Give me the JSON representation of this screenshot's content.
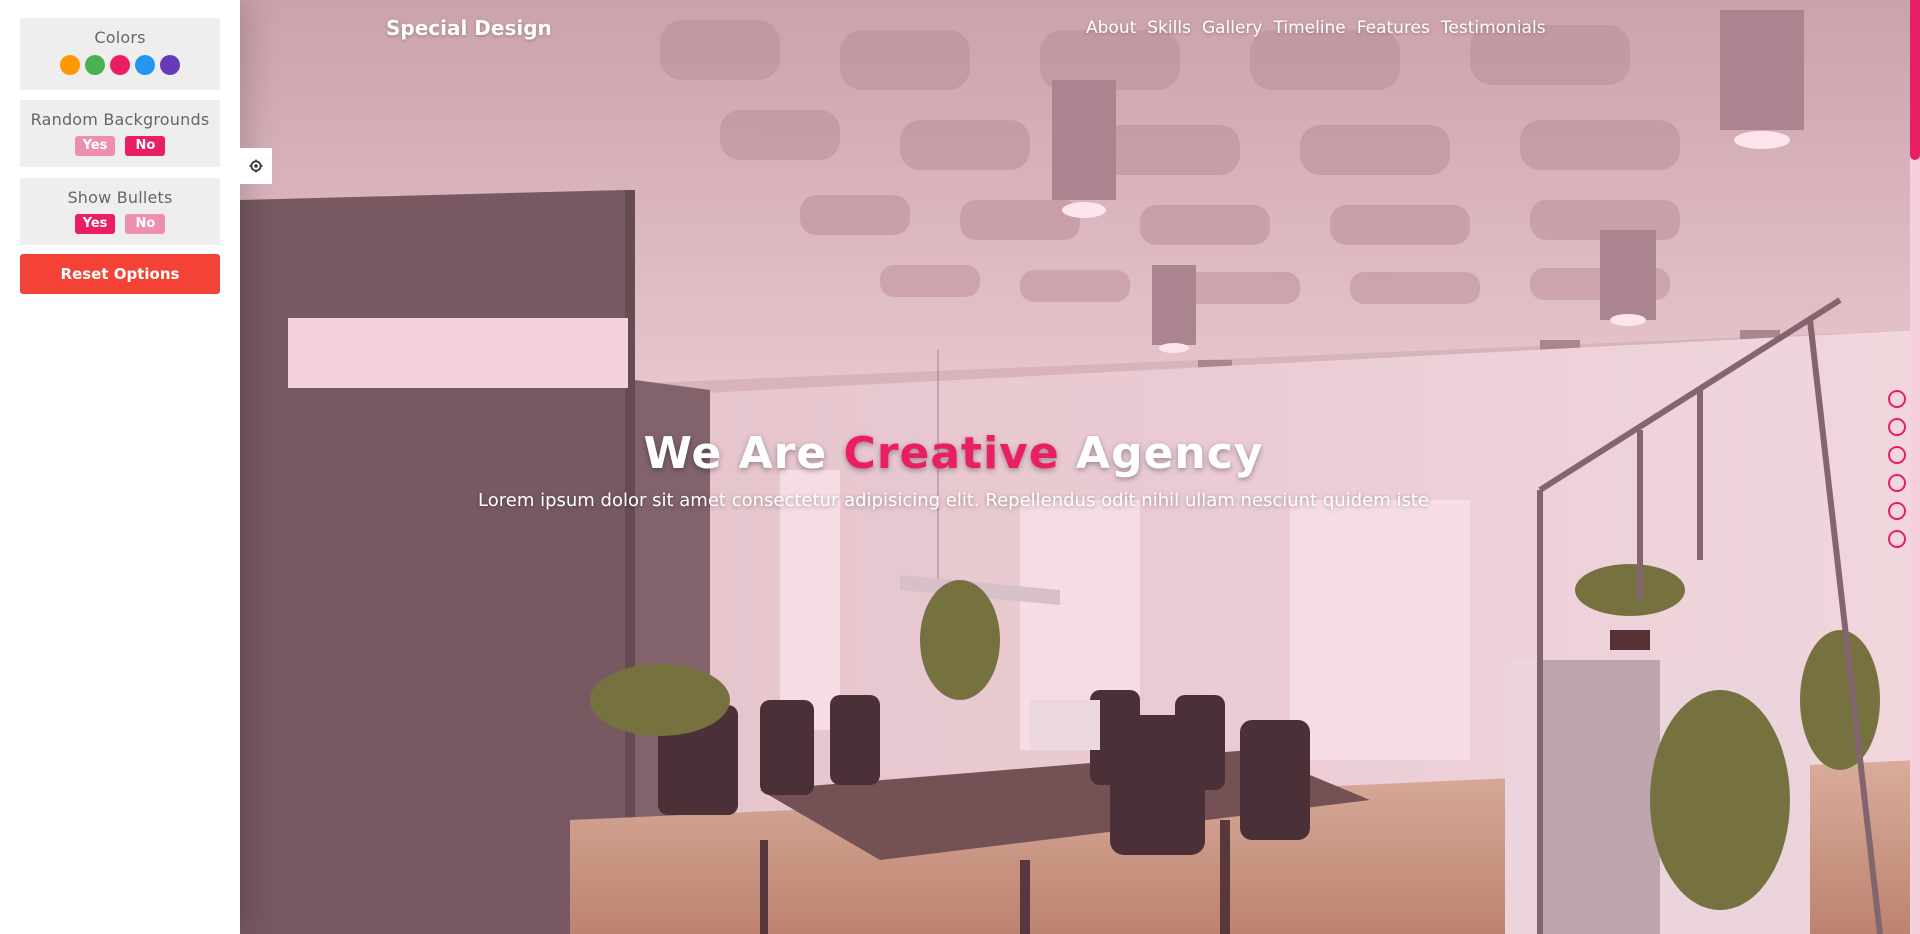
{
  "settings": {
    "colors_title": "Colors",
    "colors": [
      "#ff9800",
      "#4caf50",
      "#e91e63",
      "#2196f3",
      "#673ab7"
    ],
    "random_bg_title": "Random Backgrounds",
    "random_bg_yes": "Yes",
    "random_bg_no": "No",
    "random_bg_selected": "No",
    "bullets_title": "Show Bullets",
    "bullets_yes": "Yes",
    "bullets_no": "No",
    "bullets_selected": "Yes",
    "reset_label": "Reset Options",
    "gear_icon": "gear-icon"
  },
  "header": {
    "logo": "Special Design",
    "nav": [
      "About",
      "Skills",
      "Gallery",
      "Timeline",
      "Features",
      "Testimonials"
    ]
  },
  "intro": {
    "title_before": "We Are ",
    "title_accent": "Creative",
    "title_after": " Agency",
    "subtitle": "Lorem ipsum dolor sit amet consectetur adipisicing elit. Repellendus odit nihil ullam nesciunt quidem iste"
  },
  "theme": {
    "accent": "#e91e63",
    "reset": "#f44336"
  },
  "bullets_count": 6
}
